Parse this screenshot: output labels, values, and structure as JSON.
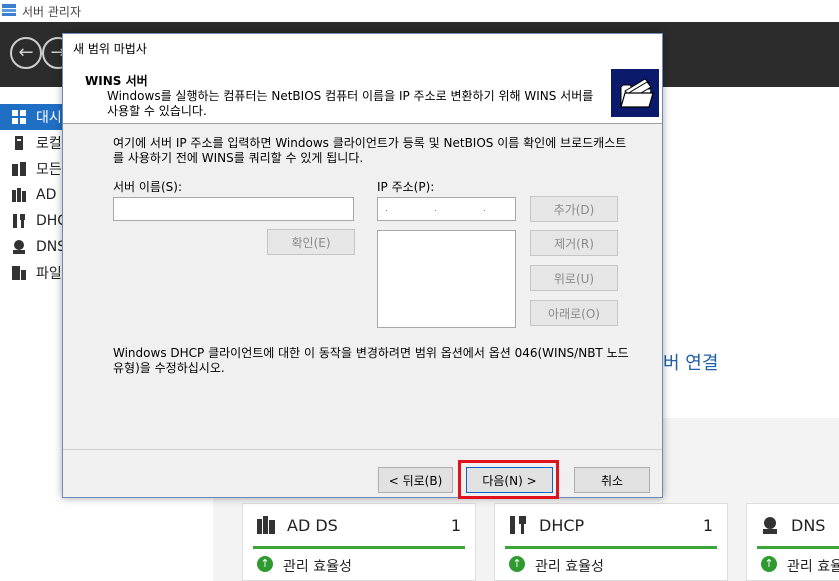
{
  "app": {
    "title": "서버 관리자"
  },
  "sidebar": {
    "items": [
      {
        "label": "대시보드",
        "icon": "dashboard-icon",
        "active": true
      },
      {
        "label": "로컬 서버",
        "icon": "local-server-icon"
      },
      {
        "label": "모든 서버",
        "icon": "all-servers-icon"
      },
      {
        "label": "AD DS",
        "icon": "ad-ds-icon"
      },
      {
        "label": "DHCP",
        "icon": "dhcp-icon"
      },
      {
        "label": "DNS",
        "icon": "dns-icon"
      },
      {
        "label": "파일 및 저장소 서비스",
        "icon": "file-storage-icon"
      }
    ]
  },
  "content": {
    "link_tail": "버 연결"
  },
  "tiles": [
    {
      "name": "AD DS",
      "count": "1",
      "status": "관리 효율성",
      "icon": "ad-ds-icon"
    },
    {
      "name": "DHCP",
      "count": "1",
      "status": "관리 효율성",
      "icon": "dhcp-icon"
    },
    {
      "name": "DNS",
      "count": "",
      "status": "관리 효율성",
      "icon": "dns-icon"
    }
  ],
  "dialog": {
    "title": "새 범위 마법사",
    "header_title": "WINS 서버",
    "header_desc": "Windows를 실행하는 컴퓨터는 NetBIOS 컴퓨터 이름을 IP 주소로 변환하기 위해 WINS 서버를 사용할 수 있습니다.",
    "instructions": "여기에 서버 IP 주소를 입력하면 Windows 클라이언트가 등록 및 NetBIOS 이름 확인에 브로드캐스트를 사용하기 전에 WINS를 쿼리할 수 있게 됩니다.",
    "server_name_label": "서버 이름(S):",
    "server_name_value": "",
    "ip_label": "IP 주소(P):",
    "ip_value": "",
    "resolve_button": "확인(E)",
    "add_button": "추가(D)",
    "remove_button": "제거(R)",
    "up_button": "위로(U)",
    "down_button": "아래로(O)",
    "note": "Windows DHCP 클라이언트에 대한 이 동작을 변경하려면 범위 옵션에서 옵션 046(WINS/NBT 노드 유형)을 수정하십시오.",
    "back_button": "< 뒤로(B)",
    "next_button": "다음(N) >",
    "cancel_button": "취소"
  },
  "colors": {
    "accent": "#1f6fc5",
    "highlight": "#e0121b",
    "status_green": "#3aa63a"
  }
}
